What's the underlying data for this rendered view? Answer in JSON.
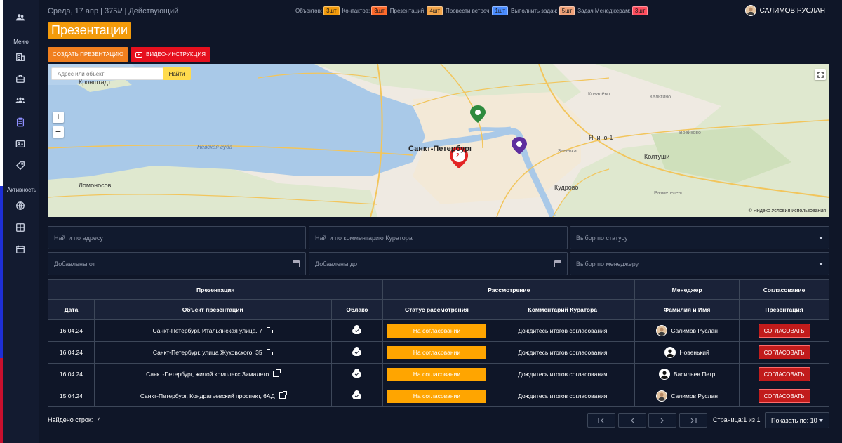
{
  "topbar": {
    "date_info": "Среда, 17 апр | 375₽ | Действующий",
    "counters": [
      {
        "label": "Объектов:",
        "badge": "3шт",
        "color": "#f39b0b"
      },
      {
        "label": "Контактов:",
        "badge": "3шт",
        "color": "#ff6a2b"
      },
      {
        "label": "Презентаций:",
        "badge": "4шт",
        "color": "#f3a54a"
      },
      {
        "label": "Провести встреч:",
        "badge": "1шт",
        "color": "#4a8cff"
      },
      {
        "label": "Выполнить задач:",
        "badge": "5шт",
        "color": "#f0a27a"
      },
      {
        "label": "Задач Менеджерам:",
        "badge": "3шт",
        "color": "#ff4d5e"
      }
    ],
    "user_name": "САЛИМОВ РУСЛАН"
  },
  "sidebar": {
    "menu_label": "Меню",
    "activity_label": "Активность",
    "icons": [
      "users-icon",
      "building-icon",
      "briefcase-icon",
      "group-icon",
      "clipboard-icon",
      "id-card-icon",
      "tag-icon",
      "globe-icon",
      "grid-icon",
      "calendar-icon"
    ]
  },
  "page": {
    "title": "Презентации",
    "create_button": "СОЗДАТЬ ПРЕЗЕНТАЦИЮ",
    "video_button": "ВИДЕО-ИНСТРУКЦИЯ"
  },
  "map": {
    "search_placeholder": "Адрес или объект",
    "find_button": "Найти",
    "zoom_in": "+",
    "zoom_out": "−",
    "labels": {
      "kronshtadt": "Кронштадт",
      "neva_bay": "Невская губа",
      "lomonosov": "Ломоносов",
      "spb": "Санкт-Петербург",
      "yanino": "Янино-1",
      "koltushi": "Колтуши",
      "kudrovo": "Кудрово",
      "kovalevo": "Ковалёво",
      "kaltino": "Кальтино",
      "voeykovo": "Воейково",
      "zanevka": "Заневка",
      "razmetelevo": "Разметелево"
    },
    "cluster_count": "2",
    "copyright": "© Яндекс",
    "terms": "Условия использования"
  },
  "filters": {
    "address": "Найти по адресу",
    "comment": "Найти по комментарию Куратора",
    "status": "Выбор по статусу",
    "added_from": "Добавлены от",
    "added_to": "Добавлены до",
    "manager": "Выбор по менеджеру"
  },
  "table": {
    "group_headers": [
      "Презентация",
      "Рассмотрение",
      "Менеджер",
      "Согласование"
    ],
    "columns": [
      "Дата",
      "Объект презентации",
      "Облако",
      "Статус рассмотрения",
      "Комментарий Куратора",
      "Фамилия и Имя",
      "Презентация"
    ],
    "rows": [
      {
        "date": "16.04.24",
        "object": "Санкт-Петербург, Итальянская улица, 7",
        "status": "На согласовании",
        "comment": "Дождитесь итогов согласования",
        "manager": "Салимов Руслан",
        "action": "СОГЛАСОВАТЬ"
      },
      {
        "date": "16.04.24",
        "object": "Санкт-Петербург, улица Жуковского, 35",
        "status": "На согласовании",
        "comment": "Дождитесь итогов согласования",
        "manager": "Новенький",
        "action": "СОГЛАСОВАТЬ"
      },
      {
        "date": "16.04.24",
        "object": "Санкт-Петербург, жилой комплекс Зималето",
        "status": "На согласовании",
        "comment": "Дождитесь итогов согласования",
        "manager": "Васильев Петр",
        "action": "СОГЛАСОВАТЬ"
      },
      {
        "date": "15.04.24",
        "object": "Санкт-Петербург, Кондратьевский проспект, 6АД",
        "status": "На согласовании",
        "comment": "Дождитесь итогов согласования",
        "manager": "Салимов Руслан",
        "action": "СОГЛАСОВАТЬ"
      }
    ]
  },
  "footer": {
    "found_label": "Найдено строк:",
    "found_count": "4",
    "page_info": "Страница:1 из 1",
    "per_page": "Показать по: 10"
  }
}
